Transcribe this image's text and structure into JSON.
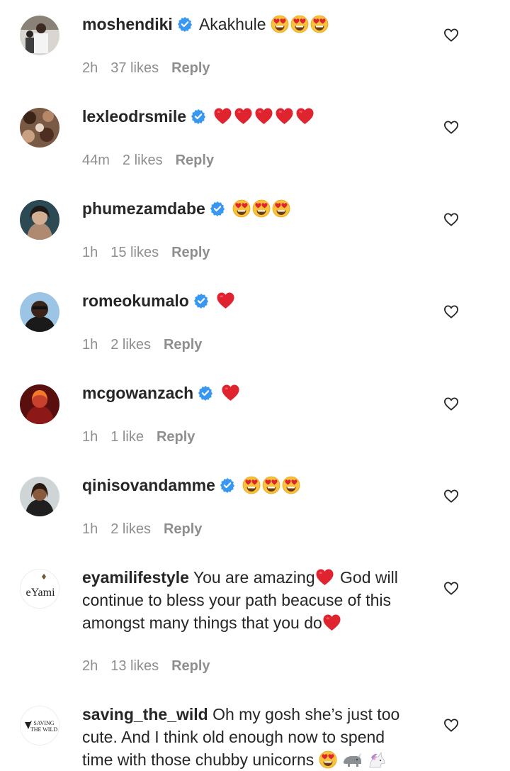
{
  "comments": [
    {
      "username": "moshendiki",
      "text": "Akakhule",
      "time": "2h",
      "likes": "37 likes",
      "reply": "Reply"
    },
    {
      "username": "lexleodrsmile",
      "text": "",
      "time": "44m",
      "likes": "2 likes",
      "reply": "Reply"
    },
    {
      "username": "phumezamdabe",
      "text": "",
      "time": "1h",
      "likes": "15 likes",
      "reply": "Reply"
    },
    {
      "username": "romeokumalo",
      "text": "",
      "time": "1h",
      "likes": "2 likes",
      "reply": "Reply"
    },
    {
      "username": "mcgowanzach",
      "text": "",
      "time": "1h",
      "likes": "1 like",
      "reply": "Reply"
    },
    {
      "username": "qinisovandamme",
      "text": "",
      "time": "1h",
      "likes": "2 likes",
      "reply": "Reply"
    },
    {
      "username": "eyamilifestyle",
      "text1": "You are amazing",
      "text2": "God will continue to bless your path beacuse of this amongst many things that you do",
      "time": "2h",
      "likes": "13 likes",
      "reply": "Reply",
      "avatar_text": "eYami"
    },
    {
      "username": "saving_the_wild",
      "text": "Oh my gosh she’s just too cute. And I think old enough now to spend time with those chubby unicorns",
      "avatar_text_1": "SAVING",
      "avatar_text_2": "THE WILD"
    }
  ],
  "icons": {
    "verified": "verified-badge-icon",
    "like": "heart-outline-icon",
    "heart_emoji": "red-heart-emoji",
    "heart_eyes": "heart-eyes-emoji"
  },
  "colors": {
    "verified": "#3897f0",
    "heart": "#e0242f",
    "muted": "#8e8e8e",
    "text": "#262626"
  }
}
